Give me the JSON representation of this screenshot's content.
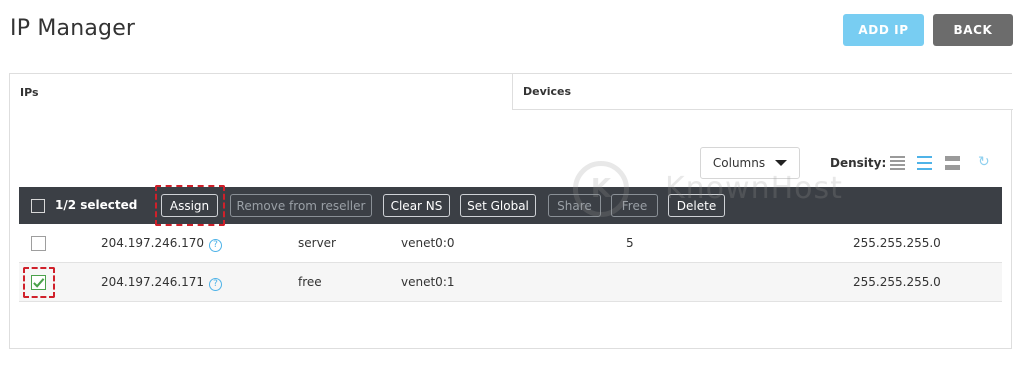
{
  "header": {
    "title": "IP Manager",
    "add_ip_label": "ADD IP",
    "back_label": "BACK"
  },
  "tabs": [
    {
      "label": "IPs"
    },
    {
      "label": "Devices"
    }
  ],
  "controls": {
    "columns_label": "Columns",
    "density_label": "Density:"
  },
  "toolbar": {
    "selected_text": "1/2 selected",
    "buttons": [
      {
        "label": "Assign"
      },
      {
        "label": "Remove from reseller"
      },
      {
        "label": "Clear NS"
      },
      {
        "label": "Set Global"
      },
      {
        "label": "Share"
      },
      {
        "label": "Free"
      },
      {
        "label": "Delete"
      }
    ]
  },
  "rows": [
    {
      "ip": "204.197.246.170",
      "status": "server",
      "iface": "venet0:0",
      "num": "5",
      "mask": "255.255.255.0",
      "checked": false
    },
    {
      "ip": "204.197.246.171",
      "status": "free",
      "iface": "venet0:1",
      "num": "",
      "mask": "255.255.255.0",
      "checked": true
    }
  ],
  "help_glyph": "?",
  "watermark": {
    "logo_letter": "K",
    "text": "KnownHost"
  },
  "colors": {
    "accent": "#78cdf2",
    "toolbar_bg": "#3b3f45",
    "highlight": "#d0202a"
  }
}
